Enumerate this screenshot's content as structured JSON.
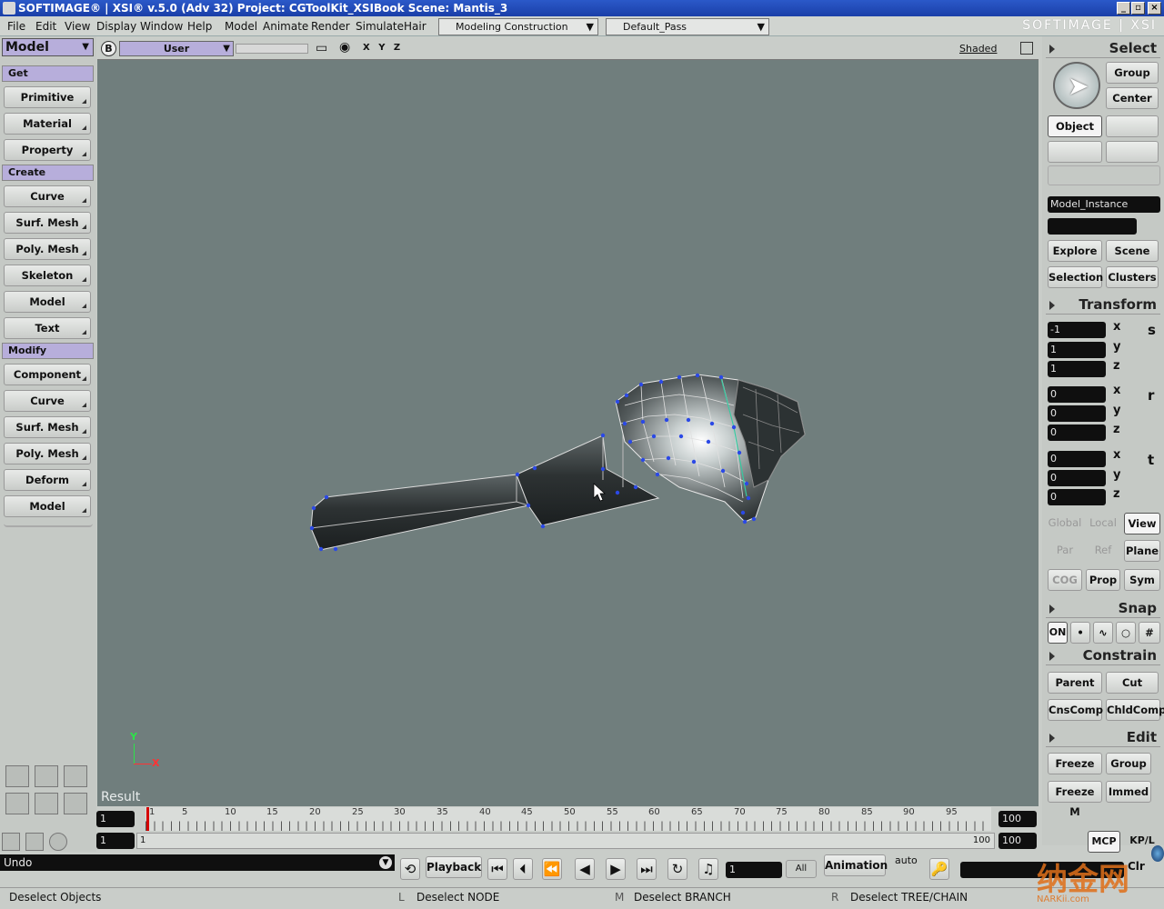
{
  "titlebar": {
    "title": "SOFTIMAGE® | XSI® v.5.0 (Adv 32) Project: CGToolKit_XSIBook    Scene: Mantis_3",
    "minimize": "_",
    "restore": "▫",
    "close": "×"
  },
  "menubar": {
    "items": [
      "File",
      "Edit",
      "View",
      "Display",
      "Window",
      "Help",
      "Model",
      "Animate",
      "Render",
      "Simulate",
      "Hair"
    ],
    "mode": "Modeling Construction Mode",
    "pass": "Default_Pass",
    "brand": "SOFTIMAGE | XSI"
  },
  "left_panel": {
    "module": "Model",
    "sections": {
      "get": "Get",
      "create": "Create",
      "modify": "Modify"
    },
    "get_buttons": [
      "Primitive",
      "Material",
      "Property"
    ],
    "create_buttons": [
      "Curve",
      "Surf. Mesh",
      "Poly. Mesh",
      "Skeleton",
      "Model",
      "Text"
    ],
    "modify_buttons": [
      "Component",
      "Curve",
      "Surf. Mesh",
      "Poly. Mesh",
      "Deform",
      "Model"
    ]
  },
  "viewport": {
    "badge": "B",
    "camera": "User",
    "axes": "X Y Z",
    "display_mode": "Shaded",
    "result_label": "Result",
    "axis_x": "X",
    "axis_y": "Y"
  },
  "right_panel": {
    "select": {
      "header": "Select",
      "group": "Group",
      "center": "Center",
      "object": "Object",
      "name_field": "Model_Instance",
      "explore": "Explore",
      "scene": "Scene",
      "selection": "Selection",
      "clusters": "Clusters"
    },
    "transform": {
      "header": "Transform",
      "scale": [
        "-1",
        "1",
        "1"
      ],
      "rotate": [
        "0",
        "0",
        "0"
      ],
      "translate": [
        "0",
        "0",
        "0"
      ],
      "axis_labels": [
        "x",
        "y",
        "z"
      ],
      "scale_label": "s",
      "rotate_label": "r",
      "translate_label": "t",
      "global": "Global",
      "local": "Local",
      "view": "View",
      "par": "Par",
      "ref": "Ref",
      "plane": "Plane",
      "cog": "COG",
      "prop": "Prop",
      "sym": "Sym"
    },
    "snap": {
      "header": "Snap",
      "on": "ON"
    },
    "constrain": {
      "header": "Constrain",
      "parent": "Parent",
      "cut": "Cut",
      "cnscomp": "CnsComp",
      "chldcomp": "ChldComp"
    },
    "edit": {
      "header": "Edit",
      "freeze": "Freeze",
      "group": "Group",
      "freeze_m": "Freeze M",
      "immed": "Immed"
    },
    "mcp": "MCP",
    "kpl": "KP/L"
  },
  "timeline": {
    "start_frame": "1",
    "current_frame": "1",
    "end_frame": "100",
    "range_end": "100",
    "range_start_label": "1",
    "range_end_label": "100",
    "ticks": [
      "1",
      "5",
      "10",
      "15",
      "20",
      "25",
      "30",
      "35",
      "40",
      "45",
      "50",
      "55",
      "60",
      "65",
      "70",
      "75",
      "80",
      "85",
      "90",
      "95"
    ]
  },
  "controls": {
    "undo": "Undo",
    "playback": "Playback",
    "frame": "1",
    "all": "All",
    "animation": "Animation",
    "auto": "auto",
    "clr": "Clr"
  },
  "status": {
    "message": "Deselect Objects",
    "l_key": "L",
    "l_action": "Deselect NODE",
    "m_key": "M",
    "m_action": "Deselect BRANCH",
    "r_key": "R",
    "r_action": "Deselect TREE/CHAIN"
  },
  "watermark": {
    "text": "纳金网",
    "sub": "NARKii.com"
  }
}
